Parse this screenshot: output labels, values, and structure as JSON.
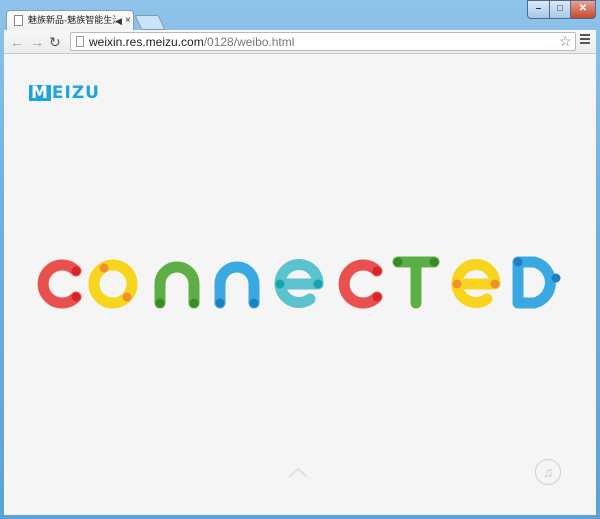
{
  "browser": {
    "tab": {
      "title": "魅族新品-魅族智能生活",
      "audio_icon": "speaker-icon",
      "close_glyph": "×"
    },
    "address": {
      "host": "weixin.res.meizu.com",
      "path": "/0128/weibo.html"
    },
    "window_controls": {
      "minimize": "–",
      "maximize": "□",
      "close": "✕"
    }
  },
  "page": {
    "logo": {
      "first_letter": "M",
      "rest": "EIZU"
    },
    "headline": "connected",
    "colors": {
      "red": "#e9514e",
      "yellow": "#f7d51f",
      "green": "#5eae46",
      "blue": "#3aa9e2",
      "teal": "#5bc3cd",
      "dot_red": "#d8232a",
      "dot_orange": "#f0902a",
      "dot_green": "#3a8a2a",
      "dot_blue": "#1b7fc1",
      "dot_teal": "#17a3ad"
    },
    "icons": {
      "scroll": "chevron-up-icon",
      "music": "music-note-icon"
    }
  }
}
